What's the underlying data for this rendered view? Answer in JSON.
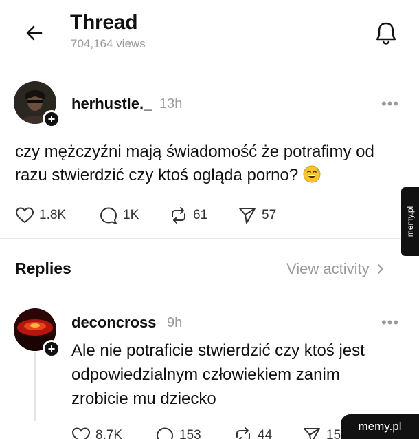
{
  "header": {
    "title": "Thread",
    "views": "704,164 views",
    "back_icon": "arrow-left-icon",
    "bell_icon": "bell-icon"
  },
  "post": {
    "username": "herhustle._",
    "time": "13h",
    "text": "czy mężczyźni mają świadomość że potrafimy od razu stwierdzić czy ktoś ogląda porno?",
    "emoji": "grinning-sweat-emoji",
    "likes": "1.8K",
    "comments": "1K",
    "reposts": "61",
    "shares": "57"
  },
  "replies_section": {
    "label": "Replies",
    "view_activity": "View activity"
  },
  "reply": {
    "username": "deconcross",
    "time": "9h",
    "text": "Ale nie potraficie stwierdzić czy ktoś jest odpowiedzialnym człowiekiem zanim zrobicie mu dziecko",
    "likes": "8.7K",
    "comments": "153",
    "reposts": "44",
    "shares": "15"
  },
  "watermark": {
    "side": "memy.pl",
    "corner": "memy.pl"
  },
  "colors": {
    "text": "#111111",
    "muted": "#9a9a9a",
    "divider": "#e6e6e6"
  }
}
